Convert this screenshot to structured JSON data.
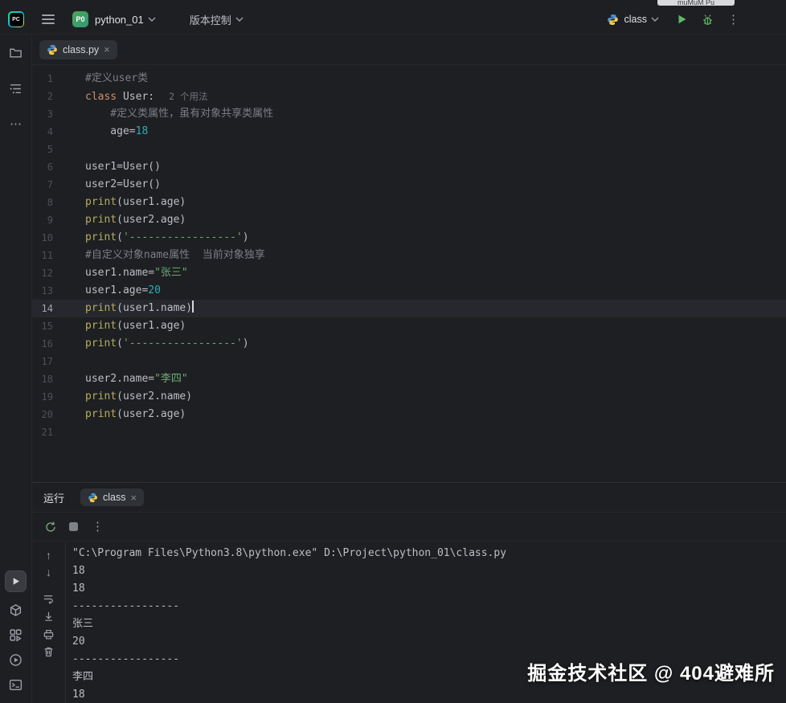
{
  "external_fragment": {
    "text": "muMuM Pu"
  },
  "icons": {
    "kebab_vertical": "⋮",
    "more_horizontal": "⋯",
    "close": "×",
    "arrow_up": "↑",
    "arrow_down": "↓"
  },
  "titlebar": {
    "logo": "PC",
    "project_badge": "P0",
    "project_name": "python_01",
    "vcs_label": "版本控制",
    "run_config_name": "class"
  },
  "editor": {
    "tab": {
      "label": "class.py"
    },
    "lines": [
      {
        "n": "1",
        "parts": [
          {
            "t": "#定义user类",
            "c": "com"
          }
        ]
      },
      {
        "n": "2",
        "parts": [
          {
            "t": "class",
            "c": "kw"
          },
          {
            "t": " User:",
            "c": "plain"
          }
        ],
        "hint": "2 个用法"
      },
      {
        "n": "3",
        "parts": [
          {
            "t": "    #定义类属性，虽有对象共享类属性",
            "c": "com"
          }
        ]
      },
      {
        "n": "4",
        "parts": [
          {
            "t": "    age=",
            "c": "plain"
          },
          {
            "t": "18",
            "c": "num"
          }
        ]
      },
      {
        "n": "5",
        "parts": []
      },
      {
        "n": "6",
        "parts": [
          {
            "t": "user1=User()",
            "c": "plain"
          }
        ]
      },
      {
        "n": "7",
        "parts": [
          {
            "t": "user2=User()",
            "c": "plain"
          }
        ]
      },
      {
        "n": "8",
        "parts": [
          {
            "t": "print",
            "c": "fn"
          },
          {
            "t": "(user1.age)",
            "c": "plain"
          }
        ]
      },
      {
        "n": "9",
        "parts": [
          {
            "t": "print",
            "c": "fn"
          },
          {
            "t": "(user2.age)",
            "c": "plain"
          }
        ]
      },
      {
        "n": "10",
        "parts": [
          {
            "t": "print",
            "c": "fn"
          },
          {
            "t": "(",
            "c": "plain"
          },
          {
            "t": "'-----------------'",
            "c": "str"
          },
          {
            "t": ")",
            "c": "plain"
          }
        ]
      },
      {
        "n": "11",
        "parts": [
          {
            "t": "#自定义对象name属性  当前对象独享",
            "c": "com"
          }
        ]
      },
      {
        "n": "12",
        "parts": [
          {
            "t": "user1.name=",
            "c": "plain"
          },
          {
            "t": "\"张三\"",
            "c": "str"
          }
        ]
      },
      {
        "n": "13",
        "parts": [
          {
            "t": "user1.age=",
            "c": "plain"
          },
          {
            "t": "20",
            "c": "num"
          }
        ]
      },
      {
        "n": "14",
        "parts": [
          {
            "t": "print",
            "c": "fn"
          },
          {
            "t": "(user1.name)",
            "c": "plain"
          }
        ],
        "current": true,
        "cursor": true
      },
      {
        "n": "15",
        "parts": [
          {
            "t": "print",
            "c": "fn"
          },
          {
            "t": "(user1.age)",
            "c": "plain"
          }
        ]
      },
      {
        "n": "16",
        "parts": [
          {
            "t": "print",
            "c": "fn"
          },
          {
            "t": "(",
            "c": "plain"
          },
          {
            "t": "'-----------------'",
            "c": "str"
          },
          {
            "t": ")",
            "c": "plain"
          }
        ]
      },
      {
        "n": "17",
        "parts": []
      },
      {
        "n": "18",
        "parts": [
          {
            "t": "user2.name=",
            "c": "plain"
          },
          {
            "t": "\"李四\"",
            "c": "str"
          }
        ]
      },
      {
        "n": "19",
        "parts": [
          {
            "t": "print",
            "c": "fn"
          },
          {
            "t": "(user2.name)",
            "c": "plain"
          }
        ]
      },
      {
        "n": "20",
        "parts": [
          {
            "t": "print",
            "c": "fn"
          },
          {
            "t": "(user2.age)",
            "c": "plain"
          }
        ]
      },
      {
        "n": "21",
        "parts": []
      }
    ]
  },
  "run_panel": {
    "title": "运行",
    "tab_label": "class",
    "console_lines": [
      "\"C:\\Program Files\\Python3.8\\python.exe\" D:\\Project\\python_01\\class.py",
      "18",
      "18",
      "-----------------",
      "张三",
      "20",
      "-----------------",
      "李四",
      "18"
    ]
  },
  "watermark": "掘金技术社区 @ 404避难所",
  "colors": {
    "background": "#1e1f22",
    "keyword": "#cf8e6d",
    "string": "#6aab73",
    "number": "#2aacb8",
    "comment": "#7a7e85",
    "builtin": "#b3ae60",
    "accent_green": "#5fb865",
    "current_line": "#26282e"
  }
}
